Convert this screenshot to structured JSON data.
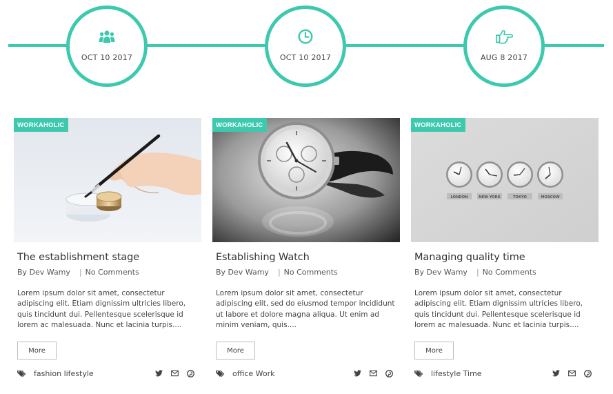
{
  "timeline": [
    {
      "icon": "group-icon",
      "date": "OCT 10 2017"
    },
    {
      "icon": "clock-icon",
      "date": "OCT 10 2017"
    },
    {
      "icon": "thumb-pointing-icon",
      "date": "AUG 8 2017"
    }
  ],
  "colors": {
    "accent": "#3cc9ad"
  },
  "posts": [
    {
      "badge": "WORKAHOLIC",
      "title": "The establishment stage",
      "author": "By Dev Wamy",
      "comments": "No Comments",
      "excerpt": "Lorem ipsum dolor sit amet, consectetur adipiscing elit. Etiam dignissim ultricies libero, quis tincidunt dui. Pellentesque scelerisque id lorem ac malesuada. Nunc et lacinia turpis....",
      "more": "More",
      "tags": "fashion lifestyle"
    },
    {
      "badge": "WORKAHOLIC",
      "title": "Establishing Watch",
      "author": "By Dev Wamy",
      "comments": "No Comments",
      "excerpt": "Lorem ipsum dolor sit amet, consectetur adipiscing elit, sed do eiusmod tempor incididunt ut labore et dolore magna aliqua. Ut enim ad minim veniam, quis....",
      "more": "More",
      "tags": "office Work"
    },
    {
      "badge": "WORKAHOLIC",
      "title": "Managing quality time",
      "author": "By Dev Wamy",
      "comments": "No Comments",
      "excerpt": "Lorem ipsum dolor sit amet, consectetur adipiscing elit. Etiam dignissim ultricies libero, quis tincidunt dui. Pellentesque scelerisque id lorem ac malesuada. Nunc et lacinia turpis....",
      "more": "More",
      "tags": "lifestyle Time",
      "clock_labels": [
        "LONDON",
        "NEW YORK",
        "TOKYO",
        "MOSCOW"
      ]
    }
  ]
}
